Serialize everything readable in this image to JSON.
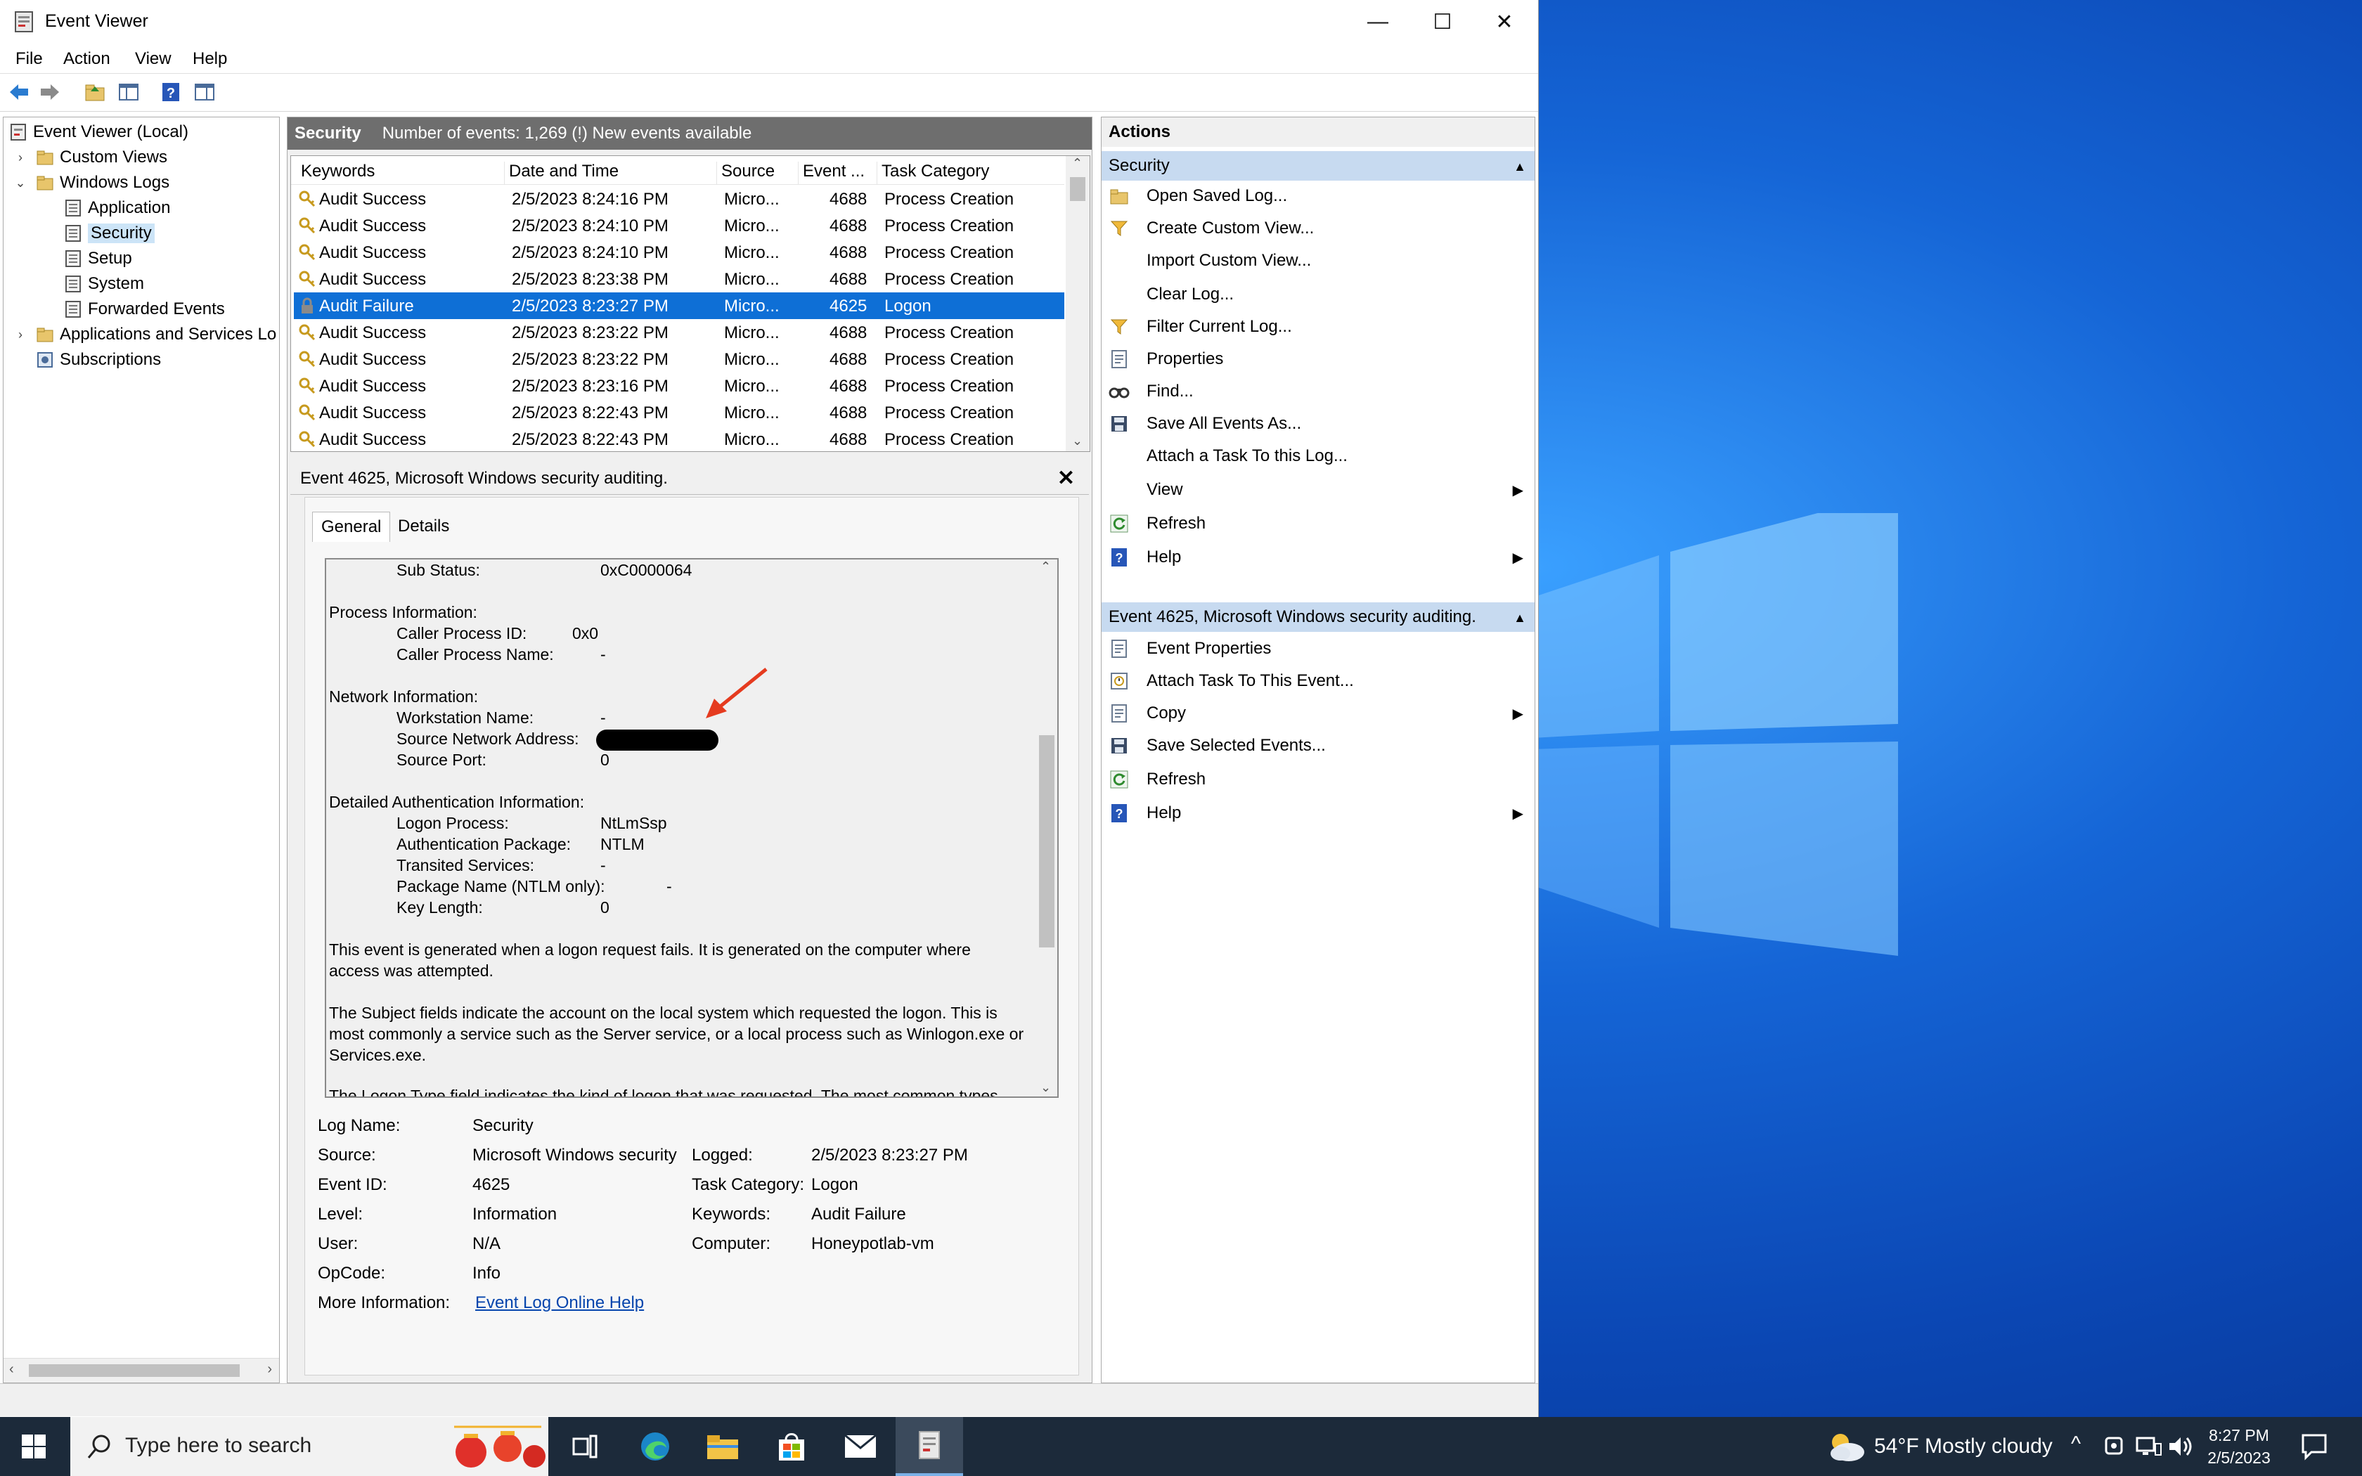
{
  "window": {
    "title": "Event Viewer",
    "min": "—",
    "max": "☐",
    "close": "✕"
  },
  "menu": [
    "File",
    "Action",
    "View",
    "Help"
  ],
  "tree": {
    "root": "Event Viewer (Local)",
    "custom_views": "Custom Views",
    "windows_logs": "Windows Logs",
    "application": "Application",
    "security": "Security",
    "setup": "Setup",
    "system": "System",
    "forwarded": "Forwarded Events",
    "apps_services": "Applications and Services Lo",
    "subscriptions": "Subscriptions"
  },
  "center": {
    "header_title": "Security",
    "header_info": "Number of events: 1,269 (!) New events available",
    "columns": [
      "Keywords",
      "Date and Time",
      "Source",
      "Event ...",
      "Task Category"
    ],
    "rows": [
      {
        "kw": "Audit Success",
        "dt": "2/5/2023 8:24:16 PM",
        "src": "Micro...",
        "id": "4688",
        "cat": "Process Creation",
        "sel": false
      },
      {
        "kw": "Audit Success",
        "dt": "2/5/2023 8:24:10 PM",
        "src": "Micro...",
        "id": "4688",
        "cat": "Process Creation",
        "sel": false
      },
      {
        "kw": "Audit Success",
        "dt": "2/5/2023 8:24:10 PM",
        "src": "Micro...",
        "id": "4688",
        "cat": "Process Creation",
        "sel": false
      },
      {
        "kw": "Audit Success",
        "dt": "2/5/2023 8:23:38 PM",
        "src": "Micro...",
        "id": "4688",
        "cat": "Process Creation",
        "sel": false
      },
      {
        "kw": "Audit Failure",
        "dt": "2/5/2023 8:23:27 PM",
        "src": "Micro...",
        "id": "4625",
        "cat": "Logon",
        "sel": true
      },
      {
        "kw": "Audit Success",
        "dt": "2/5/2023 8:23:22 PM",
        "src": "Micro...",
        "id": "4688",
        "cat": "Process Creation",
        "sel": false
      },
      {
        "kw": "Audit Success",
        "dt": "2/5/2023 8:23:22 PM",
        "src": "Micro...",
        "id": "4688",
        "cat": "Process Creation",
        "sel": false
      },
      {
        "kw": "Audit Success",
        "dt": "2/5/2023 8:23:16 PM",
        "src": "Micro...",
        "id": "4688",
        "cat": "Process Creation",
        "sel": false
      },
      {
        "kw": "Audit Success",
        "dt": "2/5/2023 8:22:43 PM",
        "src": "Micro...",
        "id": "4688",
        "cat": "Process Creation",
        "sel": false
      },
      {
        "kw": "Audit Success",
        "dt": "2/5/2023 8:22:43 PM",
        "src": "Micro...",
        "id": "4688",
        "cat": "Process Creation",
        "sel": false
      }
    ]
  },
  "detail": {
    "title": "Event 4625, Microsoft Windows security auditing.",
    "tabs": [
      "General",
      "Details"
    ],
    "desc": {
      "sub_status_label": "Sub Status:",
      "sub_status": "0xC0000064",
      "process_info": "Process Information:",
      "caller_pid_label": "Caller Process ID:",
      "caller_pid": "0x0",
      "caller_name_label": "Caller Process Name:",
      "caller_name": "-",
      "network_info": "Network Information:",
      "ws_name_label": "Workstation Name:",
      "ws_name": "-",
      "src_addr_label": "Source Network Address:",
      "src_port_label": "Source Port:",
      "src_port": "0",
      "auth_info": "Detailed Authentication Information:",
      "logon_proc_label": "Logon Process:",
      "logon_proc": "NtLmSsp",
      "auth_pkg_label": "Authentication Package:",
      "auth_pkg": "NTLM",
      "transited_label": "Transited Services:",
      "transited": "-",
      "pkg_name_label": "Package Name (NTLM only):",
      "pkg_name": "-",
      "key_len_label": "Key Length:",
      "key_len": "0",
      "para1a": "This event is generated when a logon request fails. It is generated on the computer where",
      "para1b": "access was attempted.",
      "para2a": "The Subject fields indicate the account on the local system which requested the logon. This is",
      "para2b": "most commonly a service such as the Server service, or a local process such as Winlogon.exe or",
      "para2c": "Services.exe.",
      "para3a": "The Logon Type field indicates the kind of logon that was requested. The most common types"
    },
    "meta": {
      "log_name_label": "Log Name:",
      "log_name": "Security",
      "source_label": "Source:",
      "source": "Microsoft Windows security",
      "logged_label": "Logged:",
      "logged": "2/5/2023 8:23:27 PM",
      "event_id_label": "Event ID:",
      "event_id": "4625",
      "task_cat_label": "Task Category:",
      "task_cat": "Logon",
      "level_label": "Level:",
      "level": "Information",
      "keywords_label": "Keywords:",
      "keywords": "Audit Failure",
      "user_label": "User:",
      "user": "N/A",
      "computer_label": "Computer:",
      "computer": "Honeypotlab-vm",
      "opcode_label": "OpCode:",
      "opcode": "Info",
      "more_info_label": "More Information:",
      "more_info_link": "Event Log Online Help"
    }
  },
  "actions": {
    "title": "Actions",
    "section1": "Security",
    "items1": [
      "Open Saved Log...",
      "Create Custom View...",
      "Import Custom View...",
      "Clear Log...",
      "Filter Current Log...",
      "Properties",
      "Find...",
      "Save All Events As...",
      "Attach a Task To this Log...",
      "View",
      "Refresh",
      "Help"
    ],
    "section2": "Event 4625, Microsoft Windows security auditing.",
    "items2": [
      "Event Properties",
      "Attach Task To This Event...",
      "Copy",
      "Save Selected Events...",
      "Refresh",
      "Help"
    ]
  },
  "taskbar": {
    "search_placeholder": "Type here to search",
    "weather": "54°F  Mostly cloudy",
    "time": "8:27 PM",
    "date": "2/5/2023"
  },
  "colors": {
    "selection": "#0e6fd6",
    "header_gray": "#6e6e6e",
    "section_blue": "#c7daf0",
    "annotation_arrow": "#e53b1f"
  }
}
